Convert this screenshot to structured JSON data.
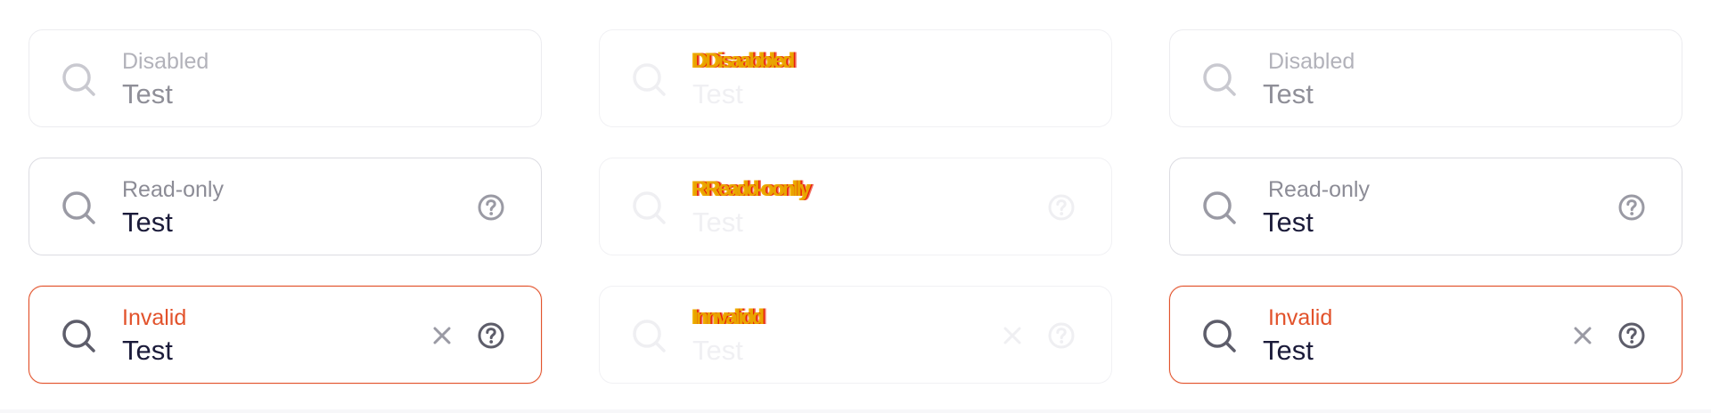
{
  "columns": [
    {
      "fields": [
        {
          "state": "disabled",
          "label": "Disabled",
          "value": "Test",
          "icons": [
            "search-icon"
          ]
        },
        {
          "state": "readonly",
          "label": "Read-only",
          "value": "Test",
          "icons": [
            "search-icon",
            "help-icon"
          ]
        },
        {
          "state": "invalid",
          "label": "Invalid",
          "value": "Test",
          "icons": [
            "search-icon",
            "clear-icon",
            "help-icon"
          ]
        }
      ]
    },
    {
      "fields": [
        {
          "state": "disabled",
          "label": "DDisaabbled",
          "value": "Test",
          "icons": [
            "search-icon"
          ]
        },
        {
          "state": "readonly",
          "label": "RReadd-oonlly",
          "value": "Test",
          "icons": [
            "search-icon",
            "help-icon"
          ]
        },
        {
          "state": "invalid",
          "label": "Innvalidd",
          "value": "Test",
          "icons": [
            "search-icon",
            "clear-icon",
            "help-icon"
          ]
        }
      ]
    },
    {
      "fields": [
        {
          "state": "disabled",
          "label": "Disabled",
          "value": "Test",
          "icons": [
            "search-icon"
          ]
        },
        {
          "state": "readonly",
          "label": "Read-only",
          "value": "Test",
          "icons": [
            "search-icon",
            "help-icon"
          ]
        },
        {
          "state": "invalid",
          "label": "Invalid",
          "value": "Test",
          "icons": [
            "search-icon",
            "clear-icon",
            "help-icon"
          ]
        }
      ]
    }
  ],
  "colors": {
    "border": "#dcdce2",
    "invalid": "#e2522b",
    "text": "#1b1b3a",
    "muted": "#8c8c96",
    "icon": "#9a9aa4"
  }
}
